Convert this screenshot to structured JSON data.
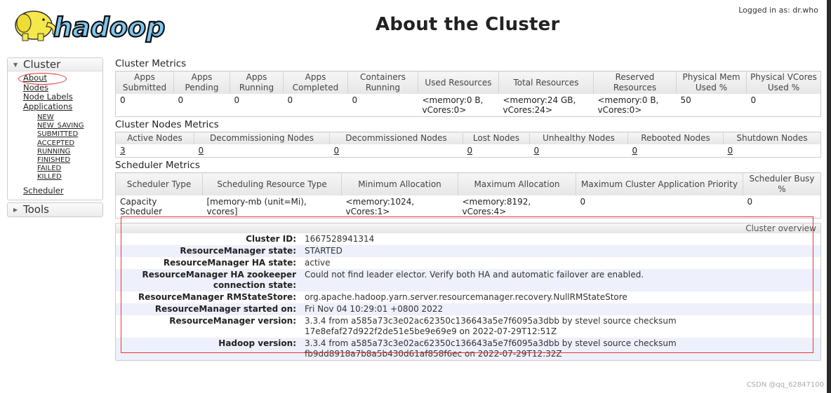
{
  "header": {
    "logo_text": "hadoop",
    "title": "About the Cluster",
    "logged_in": "Logged in as: dr.who"
  },
  "nav": {
    "cluster": {
      "label": "Cluster",
      "items": [
        {
          "label": "About"
        },
        {
          "label": "Nodes"
        },
        {
          "label": "Node Labels"
        },
        {
          "label": "Applications"
        }
      ],
      "app_states": [
        "NEW",
        "NEW_SAVING",
        "SUBMITTED",
        "ACCEPTED",
        "RUNNING",
        "FINISHED",
        "FAILED",
        "KILLED"
      ],
      "scheduler": "Scheduler"
    },
    "tools": {
      "label": "Tools"
    }
  },
  "cluster_metrics": {
    "title": "Cluster Metrics",
    "headers": [
      "Apps Submitted",
      "Apps Pending",
      "Apps Running",
      "Apps Completed",
      "Containers Running",
      "Used Resources",
      "Total Resources",
      "Reserved Resources",
      "Physical Mem Used %",
      "Physical VCores Used %"
    ],
    "values": [
      "0",
      "0",
      "0",
      "0",
      "0",
      "<memory:0 B, vCores:0>",
      "<memory:24 GB, vCores:24>",
      "<memory:0 B, vCores:0>",
      "50",
      "0"
    ]
  },
  "node_metrics": {
    "title": "Cluster Nodes Metrics",
    "headers": [
      "Active Nodes",
      "Decommissioning Nodes",
      "Decommissioned Nodes",
      "Lost Nodes",
      "Unhealthy Nodes",
      "Rebooted Nodes",
      "Shutdown Nodes"
    ],
    "values": [
      "3",
      "0",
      "0",
      "0",
      "0",
      "0",
      "0"
    ]
  },
  "scheduler_metrics": {
    "title": "Scheduler Metrics",
    "headers": [
      "Scheduler Type",
      "Scheduling Resource Type",
      "Minimum Allocation",
      "Maximum Allocation",
      "Maximum Cluster Application Priority",
      "Scheduler Busy %"
    ],
    "values": [
      "Capacity Scheduler",
      "[memory-mb (unit=Mi), vcores]",
      "<memory:1024, vCores:1>",
      "<memory:8192, vCores:4>",
      "0",
      "0"
    ]
  },
  "overview": {
    "title": "Cluster overview",
    "rows": [
      {
        "key": "Cluster ID:",
        "value": "1667528941314"
      },
      {
        "key": "ResourceManager state:",
        "value": "STARTED"
      },
      {
        "key": "ResourceManager HA state:",
        "value": "active"
      },
      {
        "key": "ResourceManager HA zookeeper connection state:",
        "value": "Could not find leader elector. Verify both HA and automatic failover are enabled."
      },
      {
        "key": "ResourceManager RMStateStore:",
        "value": "org.apache.hadoop.yarn.server.resourcemanager.recovery.NullRMStateStore"
      },
      {
        "key": "ResourceManager started on:",
        "value": "Fri Nov 04 10:29:01 +0800 2022"
      },
      {
        "key": "ResourceManager version:",
        "value": "3.3.4 from a585a73c3e02ac62350c136643a5e7f6095a3dbb by stevel source checksum 17e8efaf27d922f2de51e5be9e69e9 on 2022-07-29T12:51Z"
      },
      {
        "key": "Hadoop version:",
        "value": "3.3.4 from a585a73c3e02ac62350c136643a5e7f6095a3dbb by stevel source checksum fb9dd8918a7b8a5b430d61af858f6ec on 2022-07-29T12:32Z"
      }
    ]
  },
  "watermark": "CSDN @qq_62847100",
  "colors": {
    "highlight": "#e53935",
    "row_alt": "#eef0fb",
    "header_bg": "#e9e9e9"
  }
}
